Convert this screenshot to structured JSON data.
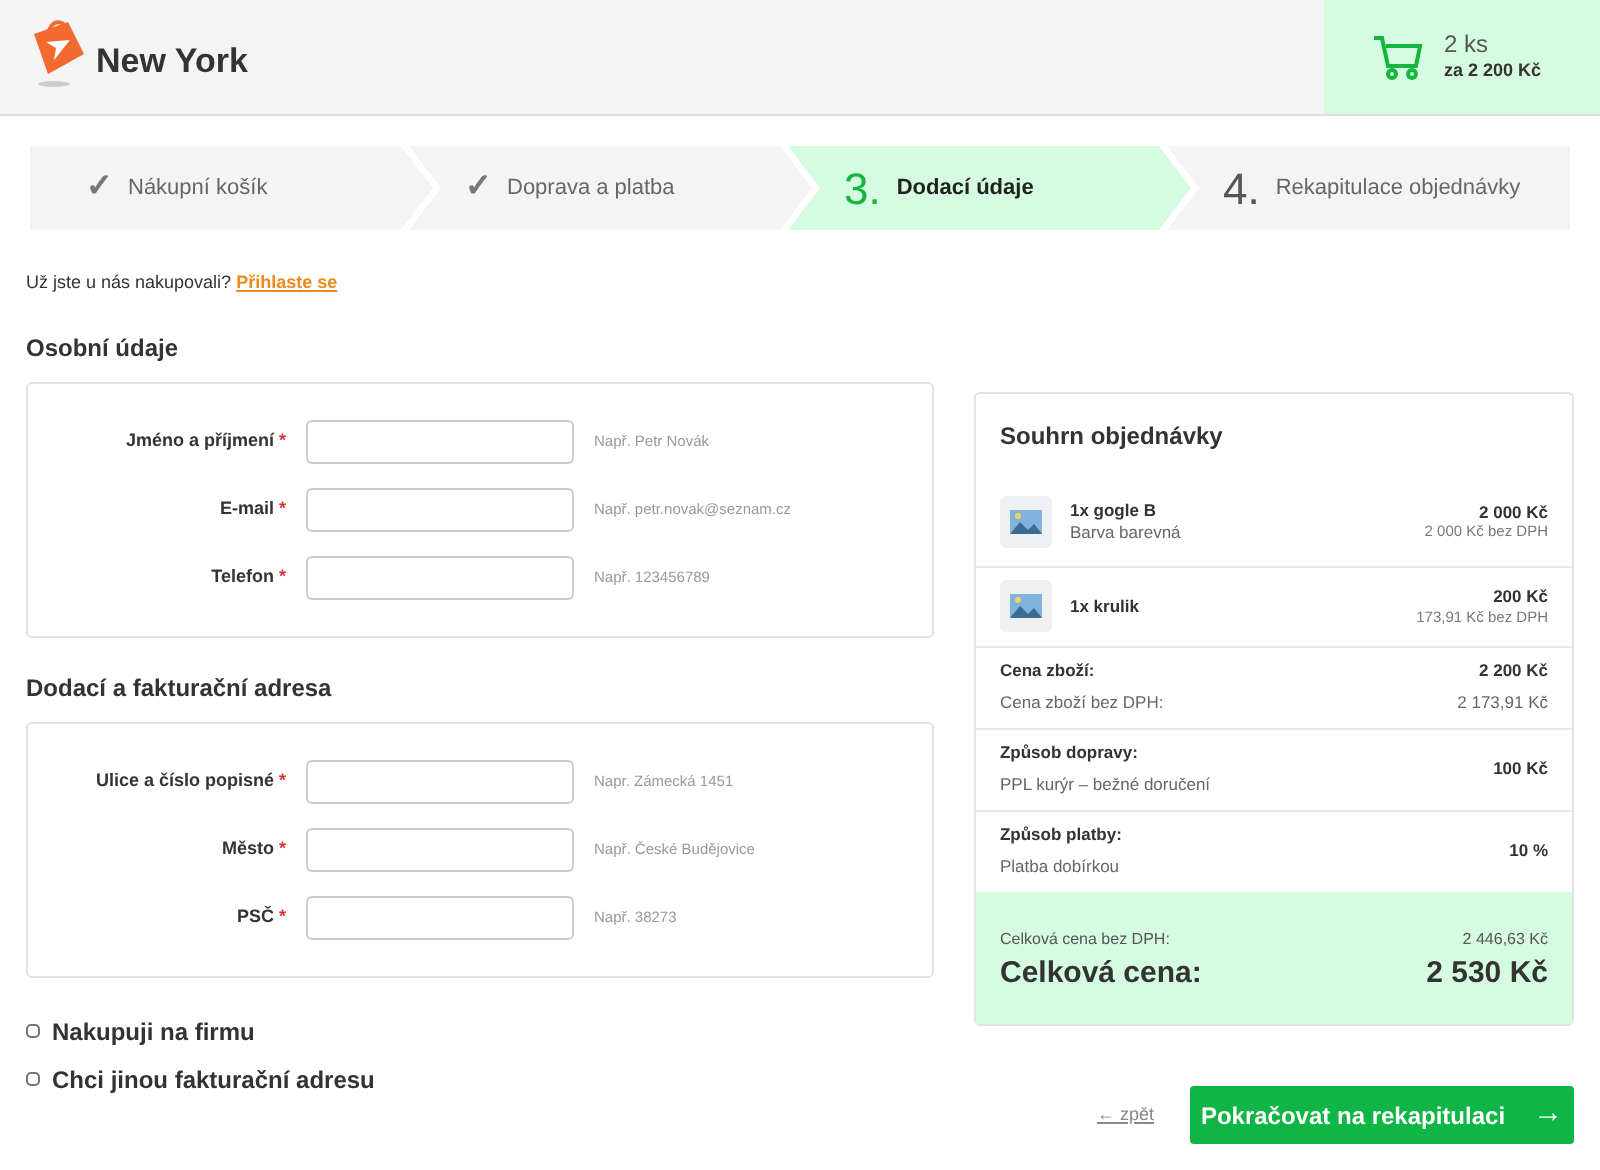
{
  "header": {
    "shop_name": "New York",
    "cart": {
      "count": "2 ks",
      "total": "za 2 200 Kč"
    }
  },
  "steps": [
    {
      "marker": "✓",
      "label": "Nákupní košík",
      "completed": true,
      "selected": false
    },
    {
      "marker": "✓",
      "label": "Doprava a platba",
      "completed": true,
      "selected": false
    },
    {
      "marker": "3.",
      "label": "Dodací údaje",
      "completed": false,
      "selected": true
    },
    {
      "marker": "4.",
      "label": "Rekapitulace objednávky",
      "completed": false,
      "selected": false
    }
  ],
  "login_prompt": {
    "text": "Už jste u nás nakupovali?",
    "link": "Přihlaste se"
  },
  "sections": [
    {
      "title": "Osobní údaje",
      "fields": [
        {
          "label": "Jméno a příjmení",
          "required_mark": "*",
          "hint": "Např. Petr Novák"
        },
        {
          "label": "E-mail",
          "required_mark": "*",
          "hint": "Např. petr.novak@seznam.cz"
        },
        {
          "label": "Telefon",
          "required_mark": "*",
          "hint": "Např. 123456789"
        }
      ]
    },
    {
      "title": "Dodací a fakturační adresa",
      "fields": [
        {
          "label": "Ulice a číslo popisné",
          "required_mark": "*",
          "hint": "Napr. Zámecká 1451"
        },
        {
          "label": "Město",
          "required_mark": "*",
          "hint": "Např. České Budějovice"
        },
        {
          "label": "PSČ",
          "required_mark": "*",
          "hint": "Např. 38273"
        }
      ]
    }
  ],
  "options": [
    {
      "label": "Nakupuji na firmu",
      "checked": false
    },
    {
      "label": "Chci jinou fakturační adresu",
      "checked": false
    }
  ],
  "summary": {
    "title": "Souhrn objednávky",
    "items": [
      {
        "name": "1x gogle B",
        "variant": "Barva barevná",
        "price": "2 000 Kč",
        "price_ex_vat": "2 000 Kč bez DPH"
      },
      {
        "name": "1x krulik",
        "price": "200 Kč",
        "price_ex_vat": "173,91 Kč bez DPH"
      }
    ],
    "rows": [
      {
        "title": "Cena zboží:",
        "value": "2 200 Kč",
        "subtitle": "Cena zboží bez DPH:",
        "subvalue": "2 173,91 Kč"
      },
      {
        "title": "Způsob dopravy:",
        "subtitle": "PPL kurýr – bežné doručení",
        "value": "100 Kč"
      },
      {
        "title": "Způsob platby:",
        "subtitle": "Platba dobírkou",
        "value": "10 %"
      }
    ],
    "total_ex_vat_label": "Celková cena bez DPH:",
    "total_ex_vat": "2 446,63 Kč",
    "total_label": "Celková cena:",
    "total": "2 530 Kč"
  },
  "back_link": {
    "arrow": "←",
    "label": "zpět"
  },
  "continue_button": {
    "label": "Pokračovat na rekapitulaci",
    "arrow": "→"
  }
}
